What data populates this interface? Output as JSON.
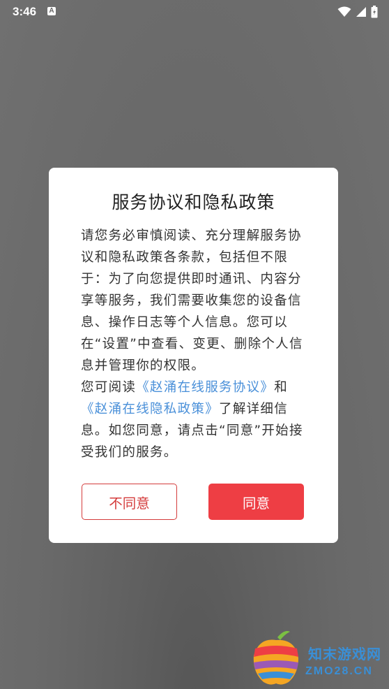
{
  "status_bar": {
    "time": "3:46",
    "notification_icon_letter": "A",
    "icons": [
      "wifi-icon",
      "signal-icon",
      "battery-icon"
    ]
  },
  "dialog": {
    "title": "服务协议和隐私政策",
    "body_line1": "请您务必审慎阅读、充分理解服务协议和隐私政策各条款，包括但不限于：为了向您提供即时通讯、内容分享等服务，我们需要收集您的设备信息、操作日志等个人信息。您可以在“设置”中查看、变更、删除个人信息并管理你的权限。",
    "body_prefix": "您可阅读",
    "service_agreement_link": "《赵涌在线服务协议》",
    "and_word": "和",
    "privacy_policy_link": "《赵涌在线隐私政策》",
    "body_suffix": "了解详细信息。如您同意，请点击“同意”开始接受我们的服务。",
    "disagree_button": "不同意",
    "agree_button": "同意"
  },
  "watermark": {
    "name": "知末游戏网",
    "domain": "ZMO28.CN"
  },
  "colors": {
    "accent_red": "#ee3e44",
    "link_blue": "#4a90d9",
    "overlay_gray": "#6a6a6a"
  }
}
